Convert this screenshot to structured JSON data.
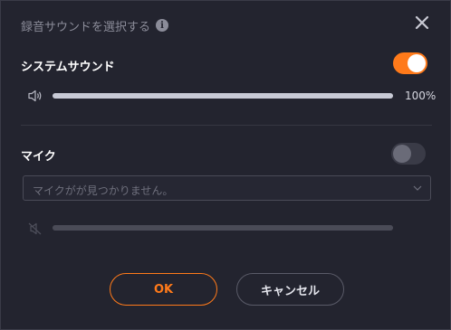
{
  "dialog": {
    "title": "録音サウンドを選択する",
    "info_icon_glyph": "i"
  },
  "system_sound": {
    "label": "システムサウンド",
    "enabled": true,
    "volume_percent": 100,
    "volume_label": "100%"
  },
  "microphone": {
    "label": "マイク",
    "enabled": false,
    "select_placeholder": "マイクがが見つかりません。",
    "volume_percent": 100
  },
  "buttons": {
    "ok_label": "OK",
    "cancel_label": "キャンセル"
  },
  "colors": {
    "accent": "#ff7a1a",
    "background": "#23242f"
  },
  "icons": {
    "info": "info-icon",
    "close": "close-icon",
    "speaker": "speaker-icon",
    "speaker_muted": "speaker-muted-icon",
    "chevron": "chevron-down-icon"
  }
}
